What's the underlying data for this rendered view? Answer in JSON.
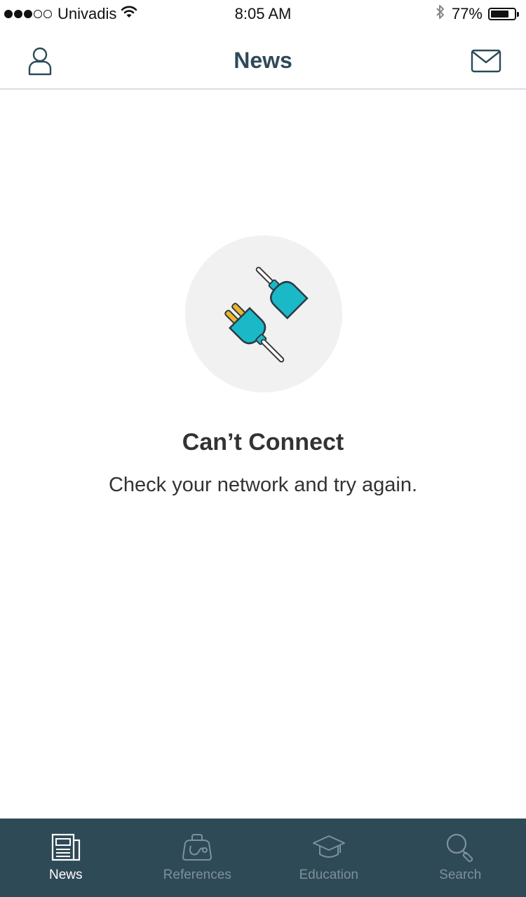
{
  "status_bar": {
    "carrier": "Univadis",
    "time": "8:05 AM",
    "battery_percent": "77%",
    "battery_level": 0.77,
    "signal_bars_filled": 3,
    "signal_bars_total": 5
  },
  "header": {
    "title": "News",
    "left_icon": "profile-icon",
    "right_icon": "mail-icon"
  },
  "empty_state": {
    "icon": "unplugged-icon",
    "title": "Can’t Connect",
    "message": "Check your network and try again."
  },
  "tab_bar": {
    "tabs": [
      {
        "label": "News",
        "icon": "newspaper-icon",
        "active": true
      },
      {
        "label": "References",
        "icon": "medical-bag-icon",
        "active": false
      },
      {
        "label": "Education",
        "icon": "graduation-cap-icon",
        "active": false
      },
      {
        "label": "Search",
        "icon": "search-icon",
        "active": false
      }
    ]
  },
  "colors": {
    "header_title": "#2d4a58",
    "tab_bar_bg": "#2f4a57",
    "tab_active": "#ffffff",
    "tab_inactive": "#7d919b",
    "plug_teal": "#1bb8c8",
    "plug_prong": "#f0b429"
  }
}
